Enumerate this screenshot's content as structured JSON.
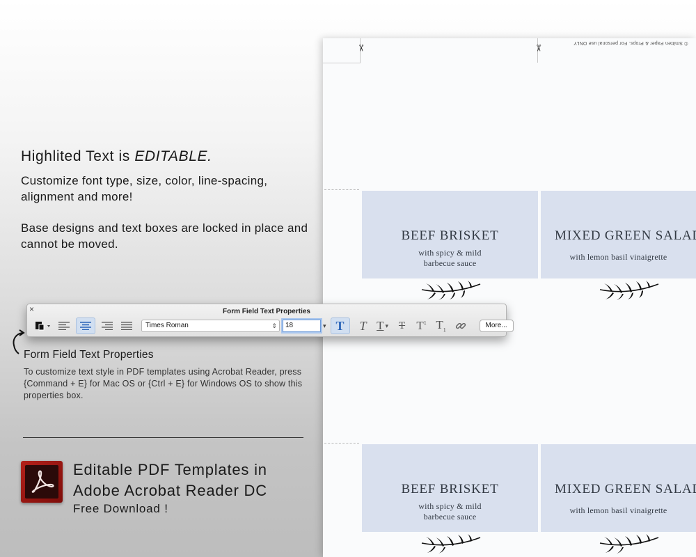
{
  "intro": {
    "title_prefix": "Highlited Text is ",
    "title_emph": "EDITABLE.",
    "para1": "Customize font type, size, color, line-spacing, alignment and more!",
    "para2": "Base designs and text boxes are locked in place and  cannot be moved."
  },
  "toolbar": {
    "title": "Form Field Text Properties",
    "close": "×",
    "font_family_value": "Times Roman",
    "font_size_value": "18",
    "more_label": "More...",
    "align_selected": "center"
  },
  "help": {
    "title": "Form Field Text Properties",
    "body": "To customize text style in PDF templates using Acrobat Reader, press {Command + E} for Mac OS or {Ctrl + E} for Windows OS to show this properties box."
  },
  "promo": {
    "line1": "Editable PDF Templates in",
    "line2": "Adobe Acrobat Reader DC",
    "sub": "Free Download !"
  },
  "sheet": {
    "copyright": "© Smitten Paper & Props. For personal use ONLY",
    "cards": [
      {
        "dish": "BEEF BRISKET",
        "desc": "with spicy & mild\nbarbecue sauce"
      },
      {
        "dish": "MIXED GREEN SALAD",
        "desc": "with lemon basil vinaigrette"
      },
      {
        "dish": "BEEF BRISKET",
        "desc": "with spicy & mild\nbarbecue sauce"
      },
      {
        "dish": "MIXED GREEN SALAD",
        "desc": "with lemon basil vinaigrette"
      }
    ]
  },
  "colors": {
    "card_bg": "#d9e0ee",
    "accent": "#2a64b8",
    "acrobat_red": "#b3211a"
  }
}
